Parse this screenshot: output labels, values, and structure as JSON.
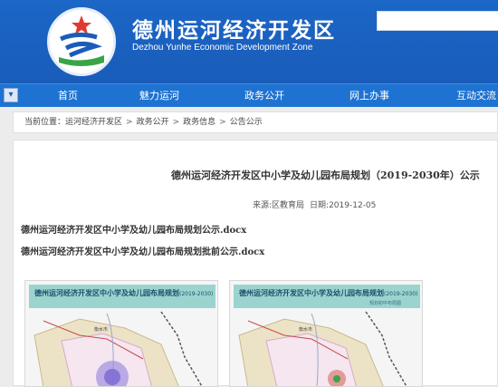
{
  "header": {
    "title": "德州运河经济开发区",
    "subtitle": "Dezhou Yunhe Economic Development Zone"
  },
  "nav": {
    "items": [
      {
        "label": "首页"
      },
      {
        "label": "魅力运河"
      },
      {
        "label": "政务公开"
      },
      {
        "label": "网上办事"
      },
      {
        "label": "互动交流"
      }
    ]
  },
  "breadcrumb": {
    "prefix": "当前位置：",
    "items": [
      "运河经济开发区",
      "政务公开",
      "政务信息",
      "公告公示"
    ],
    "separator": ">"
  },
  "article": {
    "title": "德州运河经济开发区中小学及幼儿园布局规划（2019-2030年）公示",
    "source": "来源:区教育局",
    "date": "日期:2019-12-05",
    "attachments": [
      "德州运河经济开发区中小学及幼儿园布局规划公示.docx",
      "德州运河经济开发区中小学及幼儿园布局规划批前公示.docx"
    ],
    "maps": [
      {
        "title": "德州运河经济开发区中小学及幼儿园布局规划",
        "year": "(2019-2030)",
        "subtitle": "",
        "place": "衡水市"
      },
      {
        "title": "德州运河经济开发区中小学及幼儿园布局规划",
        "year": "(2019-2030)",
        "subtitle": "规划初中布局图",
        "place": "衡水市"
      }
    ]
  },
  "colors": {
    "header_bg": "#1a5cb9",
    "nav_bg": "#1e73d2",
    "map_header": "#9bd4cf"
  }
}
